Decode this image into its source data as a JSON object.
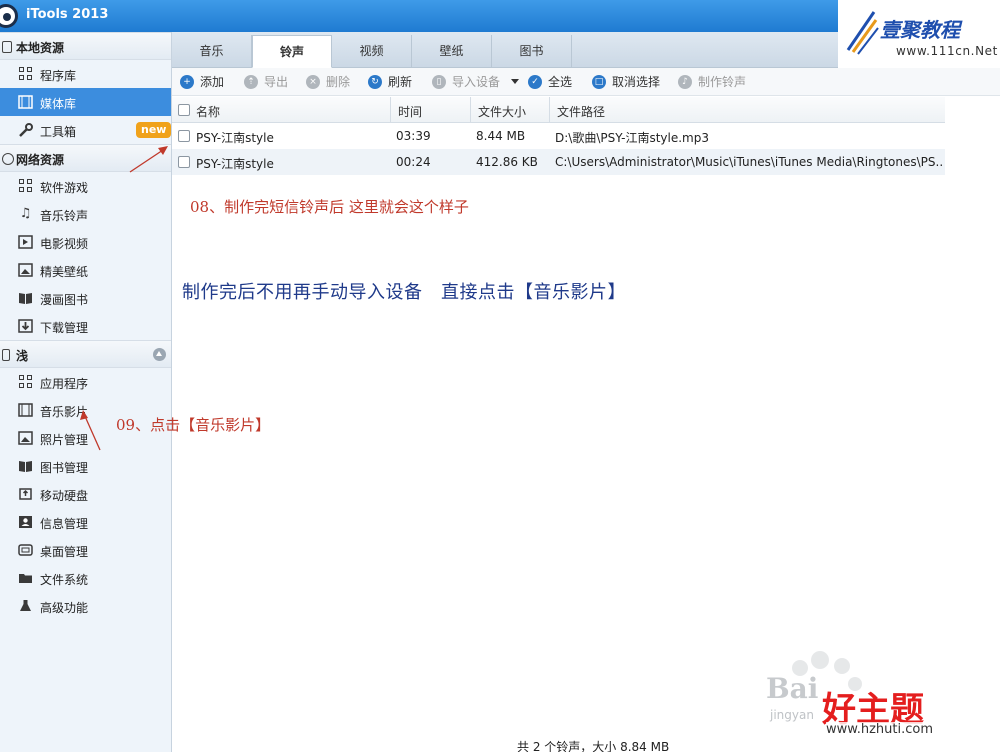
{
  "app": {
    "title": "iTools 2013"
  },
  "sidebar": {
    "local_header": "本地资源",
    "local_items": [
      {
        "label": "程序库",
        "icon": "grid-icon"
      },
      {
        "label": "媒体库",
        "icon": "film-icon",
        "active": true
      },
      {
        "label": "工具箱",
        "icon": "wrench-icon",
        "badge": "new"
      }
    ],
    "network_header": "网络资源",
    "network_items": [
      {
        "label": "软件游戏",
        "icon": "grid-icon"
      },
      {
        "label": "音乐铃声",
        "icon": "music-icon"
      },
      {
        "label": "电影视频",
        "icon": "video-icon"
      },
      {
        "label": "精美壁纸",
        "icon": "image-icon"
      },
      {
        "label": "漫画图书",
        "icon": "book-icon"
      },
      {
        "label": "下载管理",
        "icon": "download-icon"
      }
    ],
    "device_header": "浅",
    "device_items": [
      {
        "label": "应用程序",
        "icon": "grid-icon"
      },
      {
        "label": "音乐影片",
        "icon": "film-icon"
      },
      {
        "label": "照片管理",
        "icon": "image-icon"
      },
      {
        "label": "图书管理",
        "icon": "book-icon"
      },
      {
        "label": "移动硬盘",
        "icon": "usb-icon"
      },
      {
        "label": "信息管理",
        "icon": "contact-icon"
      },
      {
        "label": "桌面管理",
        "icon": "desktop-icon"
      },
      {
        "label": "文件系统",
        "icon": "folder-icon"
      },
      {
        "label": "高级功能",
        "icon": "flask-icon"
      }
    ]
  },
  "tabs": [
    "音乐",
    "铃声",
    "视频",
    "壁纸",
    "图书"
  ],
  "active_tab": "铃声",
  "toolbar": {
    "add": "添加",
    "export": "导出",
    "delete": "删除",
    "refresh": "刷新",
    "import_device": "导入设备",
    "select_all": "全选",
    "deselect": "取消选择",
    "make_ringtone": "制作铃声"
  },
  "table": {
    "headers": {
      "name": "名称",
      "time": "时间",
      "size": "文件大小",
      "path": "文件路径"
    },
    "rows": [
      {
        "name": "PSY-江南style",
        "time": "03:39",
        "size": "8.44 MB",
        "path": "D:\\歌曲\\PSY-江南style.mp3"
      },
      {
        "name": "PSY-江南style",
        "time": "00:24",
        "size": "412.86 KB",
        "path": "C:\\Users\\Administrator\\Music\\iTunes\\iTunes Media\\Ringtones\\PS..."
      }
    ]
  },
  "annotations": {
    "note08": "08、制作完短信铃声后 这里就会这个样子",
    "note_blue": "制作完后不用再手动导入设备　直接点击【音乐影片】",
    "note09": "09、点击【音乐影片】"
  },
  "status": {
    "text": "共 2 个铃声，大小 8.84 MB"
  },
  "watermarks": {
    "top_cn": "壹聚教程",
    "top_url": "www.111cn.Net",
    "baidu": "Bai",
    "baidu_sub": "jingyan",
    "hao": "好主题",
    "hao_url": "www.hzhuti.com"
  },
  "colors": {
    "accent": "#3c8dde",
    "note_red": "#c0392b",
    "note_blue": "#1f3a8a",
    "badge": "#f0a21b"
  }
}
